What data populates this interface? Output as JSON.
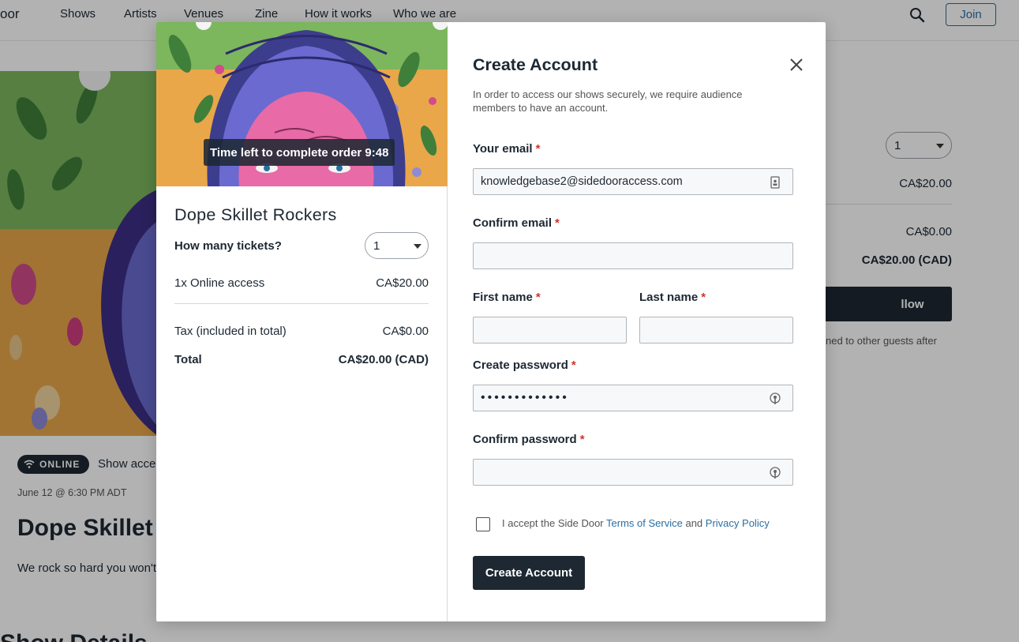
{
  "nav": {
    "logo_fragment": "oor",
    "items": [
      "Shows",
      "Artists",
      "Venues",
      "Zine",
      "How it works",
      "Who we are"
    ],
    "join_label": "Join"
  },
  "background_show": {
    "badge": "ONLINE",
    "access_text": "Show acce",
    "date": "June 12 @ 6:30 PM ADT",
    "title": "Dope Skillet",
    "description": "We rock so hard you won't",
    "section_title": "Show Details",
    "side_card": {
      "quantity": "1",
      "line_price": "CA$20.00",
      "tax": "CA$0.00",
      "total": "CA$20.00 (CAD)",
      "button_fragment": "llow",
      "note_fragment": "ned to other guests after"
    }
  },
  "order": {
    "timer_label": "Time left to complete order 9:48",
    "show_title": "Dope Skillet Rockers",
    "tickets_label": "How many tickets?",
    "quantity": "1",
    "line_item_label": "1x Online access",
    "line_item_price": "CA$20.00",
    "tax_label": "Tax (included in total)",
    "tax_value": "CA$0.00",
    "total_label": "Total",
    "total_value": "CA$20.00 (CAD)"
  },
  "form": {
    "title": "Create Account",
    "intro": "In order to access our shows securely, we require audience members to have an account.",
    "email_label": "Your email",
    "email_value": "knowledgebase2@sidedooraccess.com",
    "confirm_email_label": "Confirm email",
    "first_name_label": "First name",
    "last_name_label": "Last name",
    "password_label": "Create password",
    "password_value": "•••••••••••••",
    "confirm_password_label": "Confirm password",
    "required_mark": "*",
    "terms_prefix": "I accept the Side Door",
    "terms_link": "Terms of Service",
    "terms_and": "and",
    "privacy_link": "Privacy Policy",
    "submit_label": "Create Account"
  },
  "colors": {
    "primary": "#1d2833",
    "link": "#2a6fa3",
    "required": "#d0342c"
  }
}
